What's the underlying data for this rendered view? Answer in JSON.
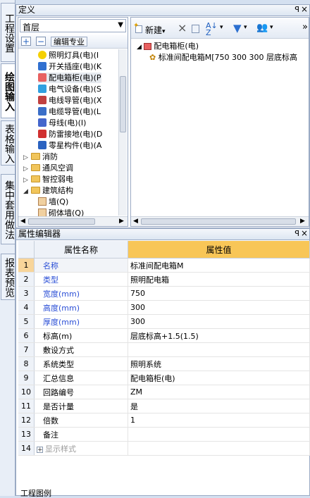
{
  "vtabs": [
    {
      "label": "工程设置",
      "active": false
    },
    {
      "label": "绘图输入",
      "active": true
    },
    {
      "label": "表格输入",
      "active": false
    },
    {
      "label": "集中套用做法",
      "active": false
    },
    {
      "label": "报表预览",
      "active": false
    }
  ],
  "def_panel": {
    "title": "定义",
    "pin": "ꟼ",
    "floor_select": "首层",
    "specialty_label": "编辑专业",
    "tree": [
      {
        "label": "照明灯具(电)(I",
        "icon": "bulb-icon"
      },
      {
        "label": "开关插座(电)(K",
        "icon": "switch-icon"
      },
      {
        "label": "配电箱柜(电)(P",
        "icon": "cabinet-icon"
      },
      {
        "label": "电气设备(电)(S",
        "icon": "equipment-icon"
      },
      {
        "label": "电线导管(电)(X",
        "icon": "wire-icon"
      },
      {
        "label": "电缆导管(电)(L",
        "icon": "cable-icon"
      },
      {
        "label": "母线(电)(I)",
        "icon": "busbar-icon"
      },
      {
        "label": "防雷接地(电)(D",
        "icon": "lightning-icon"
      },
      {
        "label": "零星构件(电)(A",
        "icon": "parts-icon"
      }
    ],
    "folders": [
      {
        "label": "消防",
        "expanded": false
      },
      {
        "label": "通风空调",
        "expanded": false
      },
      {
        "label": "智控弱电",
        "expanded": false
      },
      {
        "label": "建筑结构",
        "expanded": true
      }
    ],
    "sub_items": [
      "墙(Q)",
      "砌体墙(Q)"
    ]
  },
  "component_panel": {
    "toolbar": {
      "new_label": "新建",
      "arrow": "▾"
    },
    "root": "配电箱柜(电)",
    "child": "标准间配电箱M[750 300 300 层底标高"
  },
  "prop_panel": {
    "title": "属性编辑器",
    "header": {
      "name": "属性名称",
      "value": "属性值"
    },
    "rows": [
      {
        "num": "1",
        "name": "名称",
        "value": "标准间配电箱M",
        "style": "blue"
      },
      {
        "num": "2",
        "name": "类型",
        "value": "照明配电箱",
        "style": "blue"
      },
      {
        "num": "3",
        "name": "宽度(mm)",
        "value": "750",
        "style": "blue"
      },
      {
        "num": "4",
        "name": "高度(mm)",
        "value": "300",
        "style": "blue"
      },
      {
        "num": "5",
        "name": "厚度(mm)",
        "value": "300",
        "style": "blue"
      },
      {
        "num": "6",
        "name": "标高(m)",
        "value": "层底标高+1.5(1.5)",
        "style": ""
      },
      {
        "num": "7",
        "name": "敷设方式",
        "value": "",
        "style": ""
      },
      {
        "num": "8",
        "name": "系统类型",
        "value": "照明系统",
        "style": ""
      },
      {
        "num": "9",
        "name": "汇总信息",
        "value": "配电箱柜(电)",
        "style": ""
      },
      {
        "num": "10",
        "name": "回路编号",
        "value": "ZM",
        "style": ""
      },
      {
        "num": "11",
        "name": "是否计量",
        "value": "是",
        "style": ""
      },
      {
        "num": "12",
        "name": "倍数",
        "value": "1",
        "style": ""
      },
      {
        "num": "13",
        "name": "备注",
        "value": "",
        "style": ""
      },
      {
        "num": "14",
        "name": "显示样式",
        "value": "",
        "style": "gray"
      }
    ],
    "bottom_tab": "工程图例"
  },
  "colors": {
    "header_value_bg": "#f8c657",
    "selected_num": "#f8d59a",
    "blue_text": "#2b4fd6"
  }
}
